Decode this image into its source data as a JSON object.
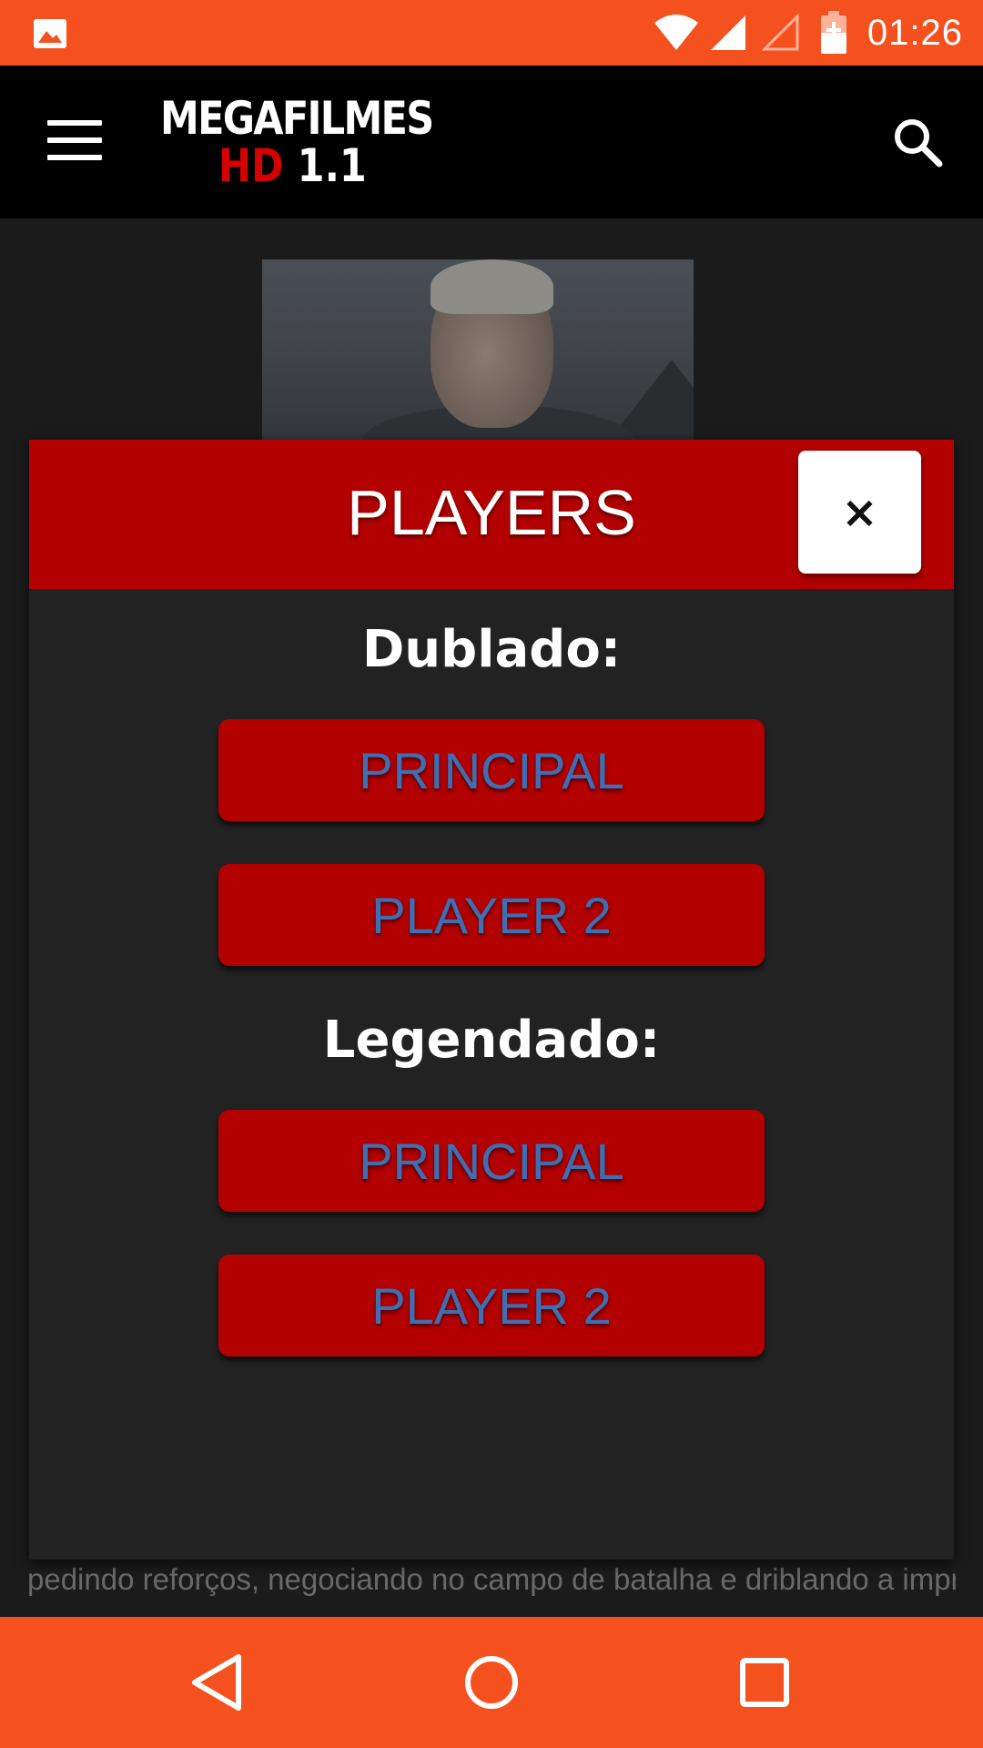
{
  "status_bar": {
    "time": "01:26",
    "color": "#f4511e",
    "icons": [
      "image-notification-icon",
      "wifi-icon",
      "signal-icon",
      "no-signal-icon",
      "battery-charging-icon"
    ]
  },
  "app_bar": {
    "logo_line1": "MEGAFILMES",
    "logo_hd": "HD",
    "logo_version": "1.1",
    "menu_icon": "hamburger-menu-icon",
    "search_icon": "search-icon"
  },
  "background": {
    "description_visible": "pedindo reforços, negociando no campo de batalha e driblando a imprensa durante a guerra."
  },
  "modal": {
    "title": "PLAYERS",
    "close_label": "×",
    "dubbed": {
      "label": "Dublado:",
      "buttons": [
        "PRINCIPAL",
        "PLAYER 2"
      ]
    },
    "subtitled": {
      "label": "Legendado:",
      "buttons": [
        "PRINCIPAL",
        "PLAYER 2"
      ]
    },
    "colors": {
      "header": "#b30000",
      "button": "#b30000",
      "button_text": "#3d6fb5",
      "body": "#222222"
    }
  },
  "nav_bar": {
    "back": "back-icon",
    "home": "home-icon",
    "recents": "recents-icon"
  }
}
